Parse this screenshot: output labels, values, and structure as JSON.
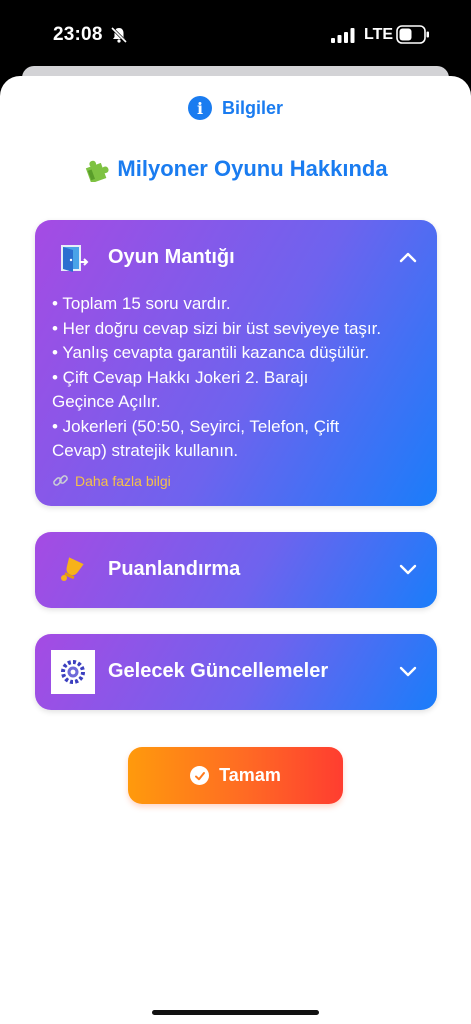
{
  "status_bar": {
    "time": "23:08",
    "network": "LTE",
    "icons": [
      "bell-slash-icon",
      "signal-bars-icon",
      "battery-icon"
    ]
  },
  "sheet": {
    "header_icon": "info-icon",
    "header_title": "Bilgiler",
    "heading_icon": "puzzle-piece-icon",
    "heading": "Milyoner Oyunu Hakkında"
  },
  "cards": [
    {
      "title": "Oyun Mantığı",
      "icon": "door-exit-icon",
      "expanded": true,
      "lines": [
        "• Toplam 15 soru vardır.",
        "• Her doğru cevap sizi bir üst seviyeye taşır.",
        "• Yanlış cevapta garantili kazanca düşülür.",
        "• Çift Cevap Hakkı Jokeri 2. Barajı Geçince Açılır.",
        "• Jokerleri (50:50, Seyirci, Telefon, Çift Cevap) stratejik kullanın."
      ],
      "link_label": "Daha fazla bilgi"
    },
    {
      "title": "Puanlandırma",
      "icon": "trophy-bell-icon",
      "expanded": false
    },
    {
      "title": "Gelecek Güncellemeler",
      "icon": "gear-badge-icon",
      "expanded": false
    }
  ],
  "ok_button": {
    "label": "Tamam",
    "icon": "check-circle-icon"
  },
  "colors": {
    "accent_blue": "#1a7cf0",
    "card_gradient_start": "#a54be3",
    "card_gradient_end": "#1a7dfa",
    "button_gradient_start": "#ff9a0c",
    "button_gradient_end": "#ff3d30",
    "link_color": "#f5c24a"
  }
}
